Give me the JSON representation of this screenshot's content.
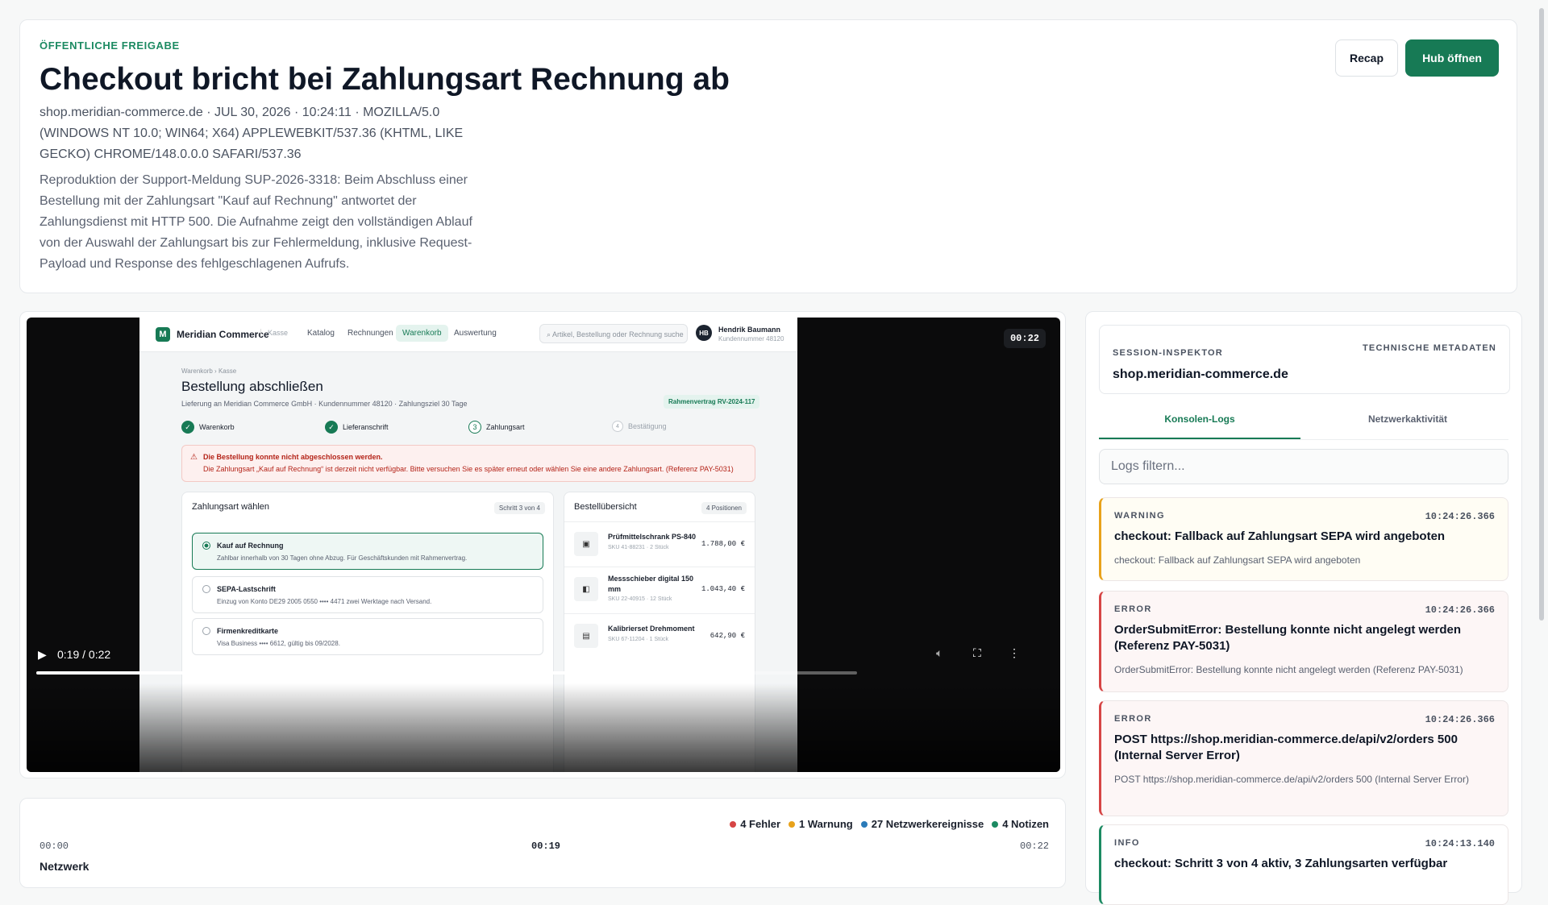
{
  "header": {
    "eyebrow": "ÖFFENTLICHE FREIGABE",
    "title": "Checkout bricht bei Zahlungsart Rechnung ab",
    "meta": "shop.meridian-commerce.de · JUL 30, 2026 · 10:24:11 · MOZILLA/5.0 (WINDOWS NT 10.0; WIN64; X64) APPLEWEBKIT/537.36 (KHTML, LIKE GECKO) CHROME/148.0.0.0 SAFARI/537.36",
    "description": "Reproduktion der Support-Meldung SUP-2026-3318: Beim Abschluss einer Bestellung mit der Zahlungsart \"Kauf auf Rechnung\" antwortet der Zahlungsdienst mit HTTP 500. Die Aufnahme zeigt den vollständigen Ablauf von der Auswahl der Zahlungsart bis zur Fehlermeldung, inklusive Request-Payload und Response des fehlgeschlagenen Aufrufs.",
    "recap_label": "Recap",
    "hub_label": "Hub öffnen",
    "accent": "#177a55"
  },
  "video": {
    "timestamp_badge": "00:22",
    "time_label": "0:19 / 0:22",
    "progress": 0.87,
    "controls": [
      "play-icon",
      "mute-icon",
      "fullscreen-icon",
      "more-icon"
    ],
    "frame": {
      "brand": "Meridian Commerce",
      "brand_sub": "Kasse",
      "logo_letter": "M",
      "nav": [
        "Katalog",
        "Rechnungen",
        "Warenkorb",
        "Auswertung"
      ],
      "nav_active": "Warenkorb",
      "search_placeholder": "Artikel, Bestellung oder Rechnung suche",
      "user_initials": "HB",
      "user_name": "Hendrik Baumann",
      "user_number": "Kundennummer 48120",
      "breadcrumb": "Warenkorb › Kasse",
      "title": "Bestellung abschließen",
      "subtitle": "Lieferung an Meridian Commerce GmbH · Kundennummer 48120 · Zahlungsziel 30 Tage",
      "contract_badge": "Rahmenvertrag RV-2024-117",
      "steps": [
        {
          "label": "Warenkorb",
          "num": "✓"
        },
        {
          "label": "Lieferanschrift",
          "num": "✓"
        },
        {
          "label": "Zahlungsart",
          "num": "3"
        },
        {
          "label": "Bestätigung",
          "num": "4"
        }
      ],
      "alert_title": "Die Bestellung konnte nicht abgeschlossen werden.",
      "alert_detail": "Die Zahlungsart „Kauf auf Rechnung“ ist derzeit nicht verfügbar. Bitte versuchen Sie es später erneut oder wählen Sie eine andere Zahlungsart. (Referenz PAY-5031)",
      "payment_title": "Zahlungsart wählen",
      "payment_badge": "Schritt 3 von 4",
      "options": [
        {
          "title": "Kauf auf Rechnung",
          "desc": "Zahlbar innerhalb von 30 Tagen ohne Abzug. Für Geschäftskunden mit Rahmenvertrag."
        },
        {
          "title": "SEPA-Lastschrift",
          "desc": "Einzug von Konto DE29 2005 0550 •••• 4471 zwei Werktage nach Versand."
        },
        {
          "title": "Firmenkreditkarte",
          "desc": "Visa Business •••• 6612, gültig bis 09/2028."
        }
      ],
      "summary_title": "Bestellübersicht",
      "summary_badge": "4 Positionen",
      "items": [
        {
          "name": "Prüfmittelschrank PS-840",
          "sku": "SKU 41-88231 · 2 Stück",
          "price": "1.788,00 €"
        },
        {
          "name": "Messschieber digital 150 mm",
          "sku": "SKU 22-40915 · 12 Stück",
          "price": "1.043,40 €"
        },
        {
          "name": "Kalibrierset Drehmoment",
          "sku": "SKU 67-11204 · 1 Stück",
          "price": "642,90 €"
        }
      ]
    }
  },
  "timeline": {
    "legend": [
      {
        "label": "4 Fehler",
        "color": "#d64545"
      },
      {
        "label": "1 Warnung",
        "color": "#e8a21a"
      },
      {
        "label": "27 Netzwerkereignisse",
        "color": "#2b7bb9"
      },
      {
        "label": "4 Notizen",
        "color": "#1c8a62"
      }
    ],
    "start": "00:00",
    "current": "00:19",
    "end": "00:22",
    "track_label": "Netzwerk"
  },
  "inspector": {
    "label": "SESSION-INSPEKTOR",
    "tech_label": "TECHNISCHE METADATEN",
    "host": "shop.meridian-commerce.de",
    "tabs": [
      "Konsolen-Logs",
      "Netzwerkaktivität"
    ],
    "filter_placeholder": "Logs filtern...",
    "logs": [
      {
        "level": "WARNING",
        "time": "10:24:26.366",
        "title": "checkout: Fallback auf Zahlungsart SEPA wird angeboten",
        "body": "checkout: Fallback auf Zahlungsart SEPA wird angeboten"
      },
      {
        "level": "ERROR",
        "time": "10:24:26.366",
        "title": "OrderSubmitError: Bestellung konnte nicht angelegt werden (Referenz PAY-5031)",
        "body": "OrderSubmitError: Bestellung konnte nicht angelegt werden (Referenz PAY-5031)"
      },
      {
        "level": "ERROR",
        "time": "10:24:26.366",
        "title": "POST https://shop.meridian-commerce.de/api/v2/orders 500 (Internal Server Error)",
        "body": "POST https://shop.meridian-commerce.de/api/v2/orders 500 (Internal Server Error)"
      },
      {
        "level": "INFO",
        "time": "10:24:13.140",
        "title": "checkout: Schritt 3 von 4 aktiv, 3 Zahlungsarten verfügbar",
        "body": ""
      }
    ]
  }
}
